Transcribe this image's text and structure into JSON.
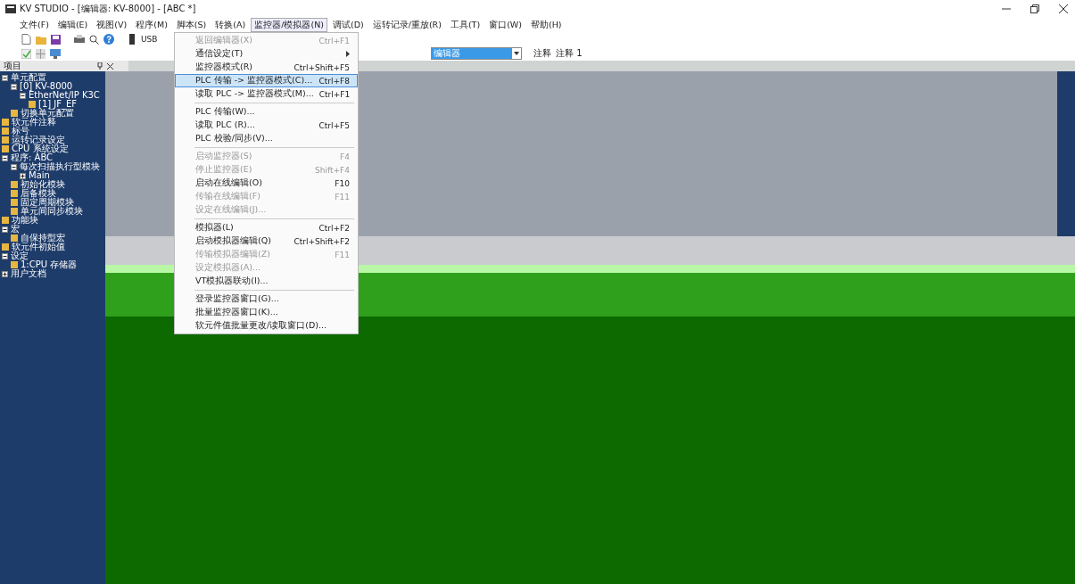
{
  "window": {
    "title": "KV STUDIO - [编辑器: KV-8000] - [ABC *]"
  },
  "menu_bar": [
    {
      "label": "文件(F)",
      "selected": false
    },
    {
      "label": "编辑(E)",
      "selected": false
    },
    {
      "label": "视图(V)",
      "selected": false
    },
    {
      "label": "程序(M)",
      "selected": false
    },
    {
      "label": "脚本(S)",
      "selected": false
    },
    {
      "label": "转换(A)",
      "selected": false
    },
    {
      "label": "监控器/模拟器(N)",
      "selected": true
    },
    {
      "label": "调试(D)",
      "selected": false
    },
    {
      "label": "运转记录/重放(R)",
      "selected": false
    },
    {
      "label": "工具(T)",
      "selected": false
    },
    {
      "label": "窗口(W)",
      "selected": false
    },
    {
      "label": "帮助(H)",
      "selected": false
    }
  ],
  "toolbar": {
    "connection": "USB",
    "mode_dropdown": "编辑器",
    "comment_label": "注释",
    "comment_dropdown": "注释 1"
  },
  "project_panel": {
    "title": "项目",
    "tree": [
      {
        "label": "单元配置",
        "expanded": true,
        "children": [
          {
            "label": "[0]  KV-8000",
            "expanded": true,
            "children": [
              {
                "label": "EtherNet/IP  K3C",
                "expanded": true,
                "children": [
                  {
                    "label": "[1]  JF_EF"
                  }
                ]
              }
            ]
          },
          {
            "label": "切换单元配置"
          }
        ]
      },
      {
        "label": "软元件注释"
      },
      {
        "label": "标号"
      },
      {
        "label": "运转记录设定"
      },
      {
        "label": "CPU 系统设定"
      },
      {
        "label": "程序: ABC",
        "expanded": true,
        "children": [
          {
            "label": "每次扫描执行型模块",
            "expanded": true,
            "children": [
              {
                "label": "Main",
                "expanded": false
              }
            ]
          },
          {
            "label": "初始化模块"
          },
          {
            "label": "后备模块"
          },
          {
            "label": "固定周期模块"
          },
          {
            "label": "单元间同步模块"
          }
        ]
      },
      {
        "label": "功能块"
      },
      {
        "label": "宏",
        "expanded": true,
        "children": [
          {
            "label": "自保持型宏"
          }
        ]
      },
      {
        "label": "软元件初始值"
      },
      {
        "label": "设定",
        "expanded": true,
        "children": [
          {
            "label": "1:CPU 存储器"
          }
        ]
      },
      {
        "label": "用户文档",
        "expanded": false
      }
    ]
  },
  "open_menu": [
    {
      "kind": "item",
      "label": "返回编辑器(X)",
      "shortcut": "Ctrl+F1",
      "disabled": true,
      "selected": false
    },
    {
      "kind": "submenu",
      "label": "通信设定(T)",
      "disabled": false,
      "selected": false
    },
    {
      "kind": "item",
      "label": "监控器模式(R)",
      "shortcut": "Ctrl+Shift+F5",
      "disabled": false,
      "selected": false
    },
    {
      "kind": "item",
      "label": "PLC 传输 -> 监控器模式(C)...",
      "shortcut": "Ctrl+F8",
      "disabled": false,
      "selected": true
    },
    {
      "kind": "item",
      "label": "读取 PLC -> 监控器模式(M)...",
      "shortcut": "Ctrl+F1",
      "disabled": false,
      "selected": false
    },
    {
      "kind": "separator"
    },
    {
      "kind": "item",
      "label": "PLC 传输(W)...",
      "disabled": false,
      "selected": false
    },
    {
      "kind": "item",
      "label": "读取 PLC (R)...",
      "shortcut": "Ctrl+F5",
      "disabled": false,
      "selected": false
    },
    {
      "kind": "item",
      "label": "PLC 校验/同步(V)...",
      "disabled": false,
      "selected": false
    },
    {
      "kind": "separator"
    },
    {
      "kind": "item",
      "label": "启动监控器(S)",
      "shortcut": "F4",
      "disabled": true,
      "selected": false
    },
    {
      "kind": "item",
      "label": "停止监控器(E)",
      "shortcut": "Shift+F4",
      "disabled": true,
      "selected": false
    },
    {
      "kind": "item",
      "label": "启动在线编辑(O)",
      "shortcut": "F10",
      "disabled": false,
      "selected": false
    },
    {
      "kind": "item",
      "label": "传输在线编辑(F)",
      "shortcut": "F11",
      "disabled": true,
      "selected": false
    },
    {
      "kind": "item",
      "label": "设定在线编辑(J)...",
      "disabled": true,
      "selected": false
    },
    {
      "kind": "separator"
    },
    {
      "kind": "item",
      "label": "模拟器(L)",
      "shortcut": "Ctrl+F2",
      "disabled": false,
      "selected": false
    },
    {
      "kind": "item",
      "label": "启动模拟器编辑(Q)",
      "shortcut": "Ctrl+Shift+F2",
      "disabled": false,
      "selected": false
    },
    {
      "kind": "item",
      "label": "传输模拟器编辑(Z)",
      "shortcut": "F11",
      "disabled": true,
      "selected": false
    },
    {
      "kind": "item",
      "label": "设定模拟器(A)...",
      "disabled": true,
      "selected": false
    },
    {
      "kind": "item",
      "label": "VT模拟器联动(I)...",
      "disabled": false,
      "selected": false
    },
    {
      "kind": "separator"
    },
    {
      "kind": "item",
      "label": "登录监控器窗口(G)...",
      "disabled": false,
      "selected": false
    },
    {
      "kind": "item",
      "label": "批量监控器窗口(K)...",
      "disabled": false,
      "selected": false
    },
    {
      "kind": "item",
      "label": "软元件值批量更改/读取窗口(D)...",
      "disabled": false,
      "selected": false
    }
  ]
}
